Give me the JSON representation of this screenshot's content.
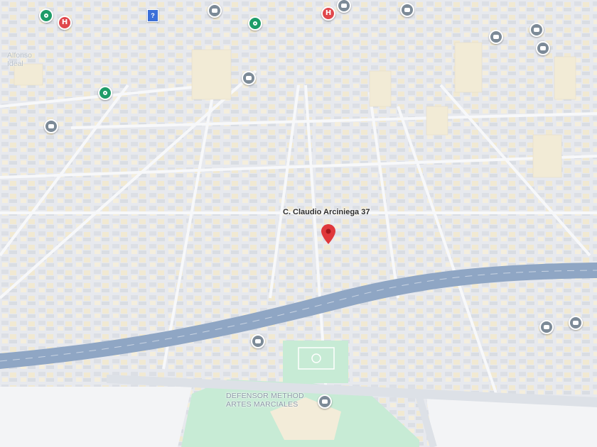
{
  "map": {
    "address_label": "C. Claudio Arciniega 37",
    "poi_label_line1": "DEFENSOR METHOD",
    "poi_label_line2": "ARTES MARCIALES",
    "district_label_line1": "Alfonso",
    "district_label_line2": "Ideal",
    "badge_text": "?",
    "hospital_glyph": "H",
    "colors": {
      "ground": "#eceef1",
      "building_beige": "#f3ecd9",
      "building_gray": "#dfe2e7",
      "highway": "#8fa6c4",
      "park": "#bfe7cf",
      "marker": "#e0383b"
    },
    "icons": [
      "location-pin-icon",
      "hospital-icon",
      "park-icon",
      "transit-icon",
      "info-square-icon"
    ]
  }
}
